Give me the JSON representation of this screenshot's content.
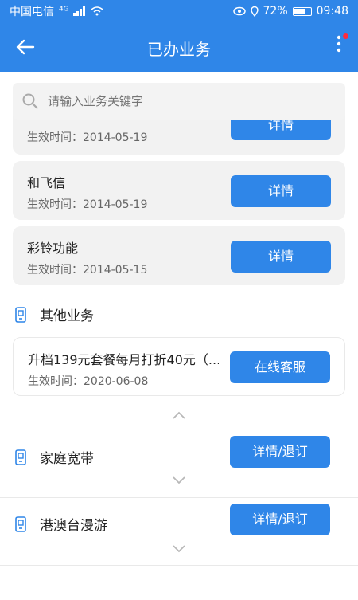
{
  "status_bar": {
    "carrier": "中国电信",
    "signal": "⁴ᴳ",
    "battery": "72%",
    "time": "09:48"
  },
  "app_bar": {
    "title": "已办业务",
    "back_icon": "back-arrow-icon",
    "more_icon": "more-vert-icon"
  },
  "search": {
    "placeholder": "请输入业务关键字"
  },
  "done_items": [
    {
      "name": "和飞信",
      "date": "生效时间：2014-05-19",
      "action": "详情"
    },
    {
      "name": "彩铃功能",
      "date": "生效时间：2014-05-15",
      "action": "详情"
    }
  ],
  "partial_item": {
    "date": "生效时间：2014-05-19",
    "action": "详情"
  },
  "sections": {
    "other": {
      "title": "其他业务",
      "item": {
        "name": "升档139元套餐每月打折40元（...",
        "date": "生效时间：2020-06-08",
        "action": "在线客服"
      }
    },
    "broadband": {
      "title": "家庭宽带",
      "action": "详情/退订"
    },
    "roaming": {
      "title": "港澳台漫游",
      "action": "详情/退订"
    }
  },
  "colors": {
    "primary": "#2f86e8",
    "card_bg": "#f2f2f2",
    "badge": "#ff2b3d"
  }
}
